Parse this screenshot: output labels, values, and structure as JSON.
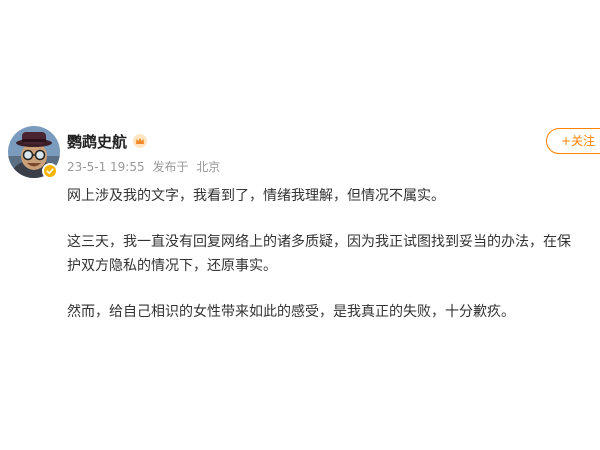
{
  "post": {
    "author": "鹦鹉史航",
    "timestamp": "23-5-1 19:55",
    "location_prefix": "发布于",
    "location": "北京",
    "follow_label": "+关注",
    "paragraphs": [
      "网上涉及我的文字，我看到了，情绪我理解，但情况不属实。",
      "这三天，我一直没有回复网络上的诸多质疑，因为我正试图找到妥当的办法，在保",
      "护双方隐私的情况下，还原事实。",
      "然而，给自己相识的女性带来如此的感受，是我真正的失败，十分歉疚。"
    ]
  },
  "icons": {
    "avatar": "avatar-image",
    "verified": "verified-badge-icon",
    "member": "crown-icon"
  },
  "colors": {
    "accent": "#ff8200",
    "meta_text": "#999999",
    "body_text": "#333333",
    "verified_badge": "#f7b500"
  }
}
